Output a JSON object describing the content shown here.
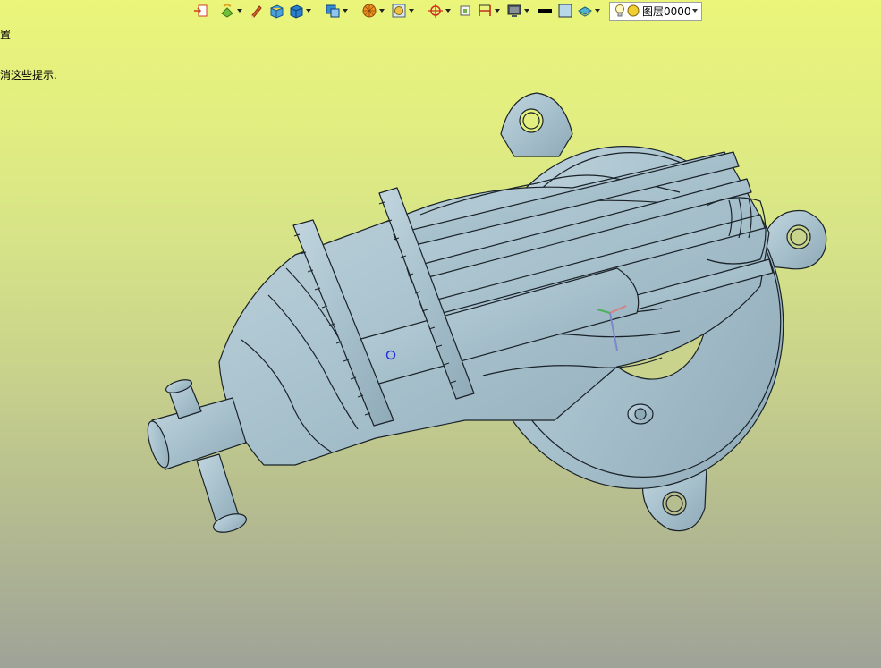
{
  "hint": {
    "line1": "置",
    "line2": "消这些提示."
  },
  "toolbar": {
    "buttons": [
      {
        "icon": "import-icon",
        "has_menu": false
      },
      {
        "icon": "layer-paint-icon",
        "has_menu": true
      },
      {
        "icon": "pencil-icon",
        "has_menu": false
      },
      {
        "icon": "solid-box-yellow-icon",
        "has_menu": false
      },
      {
        "icon": "solid-box-blue-icon",
        "has_menu": true
      },
      {
        "icon": "box-view-icon",
        "has_menu": true
      },
      {
        "icon": "sphere-shade-icon",
        "has_menu": true
      },
      {
        "icon": "frame-view-icon",
        "has_menu": true
      },
      {
        "icon": "crosshair-icon",
        "has_menu": true
      },
      {
        "icon": "small-square-icon",
        "has_menu": false
      },
      {
        "icon": "dimension-icon",
        "has_menu": true
      },
      {
        "icon": "monitor-icon",
        "has_menu": true
      },
      {
        "icon": "line-color-icon",
        "has_menu": false
      },
      {
        "icon": "fill-color-icon",
        "has_menu": false
      },
      {
        "icon": "layers-icon",
        "has_menu": true
      }
    ],
    "layer_selector": {
      "value": "图层0000"
    }
  },
  "colors": {
    "part_fill": "#a6c0cc",
    "part_edge": "#1a2228",
    "background_top": "#eaf57a",
    "background_bottom": "#9fa398"
  }
}
